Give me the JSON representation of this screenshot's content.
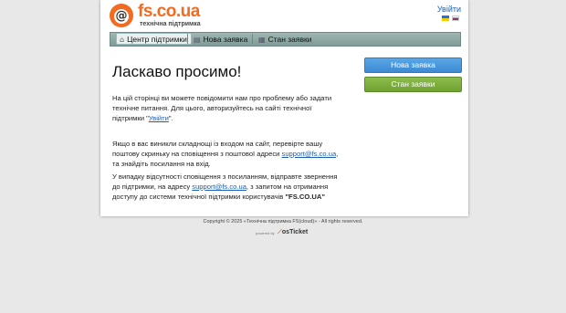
{
  "header": {
    "logo_text": "fs.co.ua",
    "logo_subtitle": "технічна підтримка",
    "login_label": "Увійти"
  },
  "nav": {
    "items": [
      {
        "label": "Центр підтримки",
        "icon": "home-icon",
        "active": true
      },
      {
        "label": "Нова заявка",
        "icon": "new-ticket-icon",
        "active": false
      },
      {
        "label": "Стан заявки",
        "icon": "ticket-status-icon",
        "active": false
      }
    ]
  },
  "main": {
    "title": "Ласкаво просимо!",
    "intro_text": "На цій сторінці ви можете повідомити нам про проблему або задати технічне питання. Для цього, авторизуйтесь на сайті технічної підтримки \"",
    "intro_link": "Увійти",
    "intro_end": "\".",
    "login_problem_text": "Якщо в вас виникли складнощі із входом на сайт, перевірте вашу поштову скриньку на сповіщення з поштової адреси ",
    "support_email": "support@fs.co.ua",
    "login_problem_end": ", та знайдіть посилання на вхід.",
    "no_notification_text": "У випадку відсутності сповіщення з посиланням, відправте звернення до підтримки, на адресу ",
    "no_notification_end": ", з запитом на отримання доступу до системи технічної підтримки користувачів ",
    "brand_quote": "\"FS.CO.UA\""
  },
  "sidebar": {
    "new_ticket_label": "Нова заявка",
    "ticket_status_label": "Стан заявки"
  },
  "footer": {
    "copyright": "Copyright © 2025 «Технічна підтримка FS(cloud)» - All rights reserved.",
    "powered_by": "powered by",
    "powered_logo": "osTicket"
  },
  "colors": {
    "brand_orange": "#f26b21",
    "nav_bar": "#8fa9a5",
    "button_blue": "#4a97dc",
    "button_green": "#7baf3e",
    "link": "#1a5fb4"
  }
}
